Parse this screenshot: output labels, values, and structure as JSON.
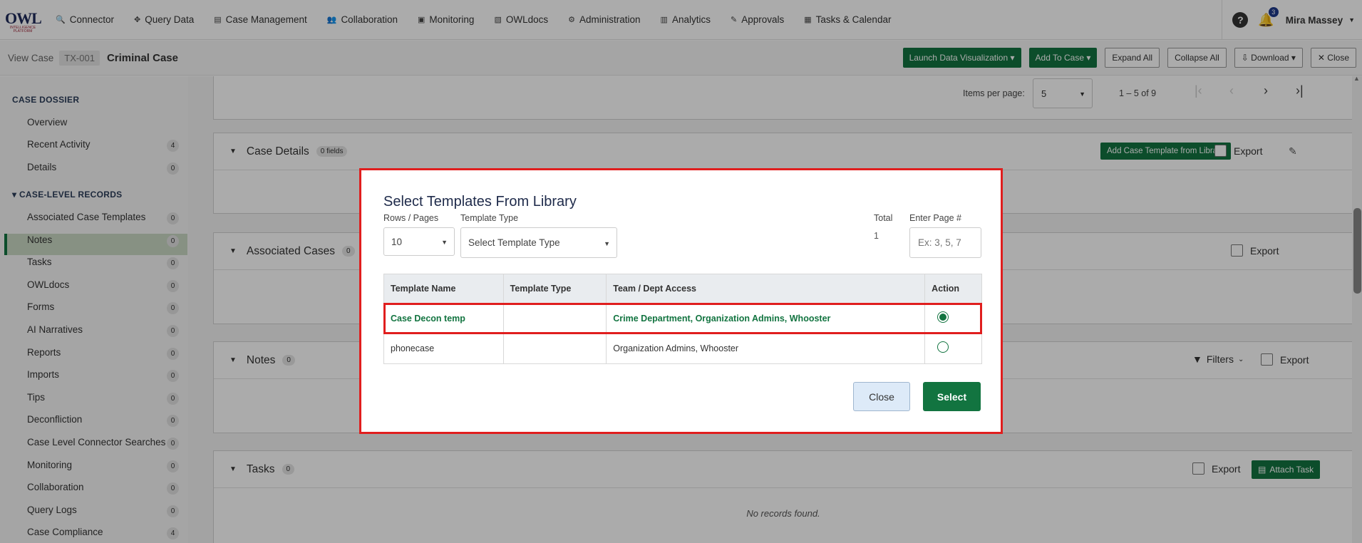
{
  "nav": {
    "logo_text": "OWL",
    "logo_sub": "INTELLIGENCE PLATFORM",
    "items": [
      {
        "label": "Connector",
        "icon": "search-icon",
        "glyph": "🔍"
      },
      {
        "label": "Query Data",
        "icon": "move-icon",
        "glyph": "✥"
      },
      {
        "label": "Case Management",
        "icon": "file-icon",
        "glyph": "▤"
      },
      {
        "label": "Collaboration",
        "icon": "users-icon",
        "glyph": "👥"
      },
      {
        "label": "Monitoring",
        "icon": "monitor-icon",
        "glyph": "▣"
      },
      {
        "label": "OWLdocs",
        "icon": "docs-icon",
        "glyph": "▧"
      },
      {
        "label": "Administration",
        "icon": "admin-icon",
        "glyph": "⚙"
      },
      {
        "label": "Analytics",
        "icon": "analytics-icon",
        "glyph": "▥"
      },
      {
        "label": "Approvals",
        "icon": "signature-icon",
        "glyph": "✎"
      },
      {
        "label": "Tasks & Calendar",
        "icon": "calendar-icon",
        "glyph": "▦"
      }
    ],
    "help_glyph": "?",
    "bell_glyph": "🔔",
    "notifications": "3",
    "user": "Mira Massey"
  },
  "subbar": {
    "view_case": "View Case",
    "case_id": "TX-001",
    "case_name": "Criminal Case",
    "buttons": {
      "launch": "Launch Data Visualization ▾",
      "add": "Add To Case ▾",
      "expand": "Expand All",
      "collapse": "Collapse All",
      "download": "⇩ Download ▾",
      "close": "✕ Close"
    }
  },
  "sidebar": {
    "dossier_header": "CASE DOSSIER",
    "records_header": "▾  CASE-LEVEL RECORDS",
    "dossier_items": [
      {
        "label": "Overview",
        "count": ""
      },
      {
        "label": "Recent Activity",
        "count": "4"
      },
      {
        "label": "Details",
        "count": "0"
      }
    ],
    "record_items": [
      {
        "label": "Associated Case Templates",
        "count": "0"
      },
      {
        "label": "Notes",
        "count": "0"
      },
      {
        "label": "Tasks",
        "count": "0"
      },
      {
        "label": "OWLdocs",
        "count": "0"
      },
      {
        "label": "Forms",
        "count": "0"
      },
      {
        "label": "AI Narratives",
        "count": "0"
      },
      {
        "label": "Reports",
        "count": "0"
      },
      {
        "label": "Imports",
        "count": "0"
      },
      {
        "label": "Tips",
        "count": "0"
      },
      {
        "label": "Deconfliction",
        "count": "0"
      },
      {
        "label": "Case Level Connector Searches",
        "count": "0"
      },
      {
        "label": "Monitoring",
        "count": "0"
      },
      {
        "label": "Collaboration",
        "count": "0"
      },
      {
        "label": "Query Logs",
        "count": "0"
      },
      {
        "label": "Case Compliance",
        "count": "4"
      }
    ]
  },
  "content": {
    "paginator": {
      "items_per_page_label": "Items per page:",
      "items_per_page": "5",
      "range": "1 – 5 of 9"
    },
    "case_details": {
      "title": "Case Details",
      "chip": "0 fields",
      "add_template": "Add Case Template from Library",
      "export": "Export"
    },
    "associated_cases": {
      "title": "Associated Cases",
      "chip": "0",
      "export": "Export"
    },
    "notes": {
      "title": "Notes",
      "chip": "0",
      "filters": "Filters",
      "export": "Export"
    },
    "tasks": {
      "title": "Tasks",
      "chip": "0",
      "export": "Export",
      "attach": "Attach Task",
      "empty": "No records found."
    }
  },
  "modal": {
    "title": "Select Templates From Library",
    "rows_label": "Rows / Pages",
    "rows_value": "10",
    "type_label": "Template Type",
    "type_placeholder": "Select Template Type",
    "total_label": "Total",
    "total_value": "1",
    "page_label": "Enter Page #",
    "page_placeholder": "Ex: 3, 5, 7",
    "columns": [
      "Template Name",
      "Template Type",
      "Team / Dept Access",
      "Action"
    ],
    "rows": [
      {
        "name": "Case Decon temp",
        "type": "",
        "access": "Crime Department, Organization Admins, Whooster",
        "selected": true
      },
      {
        "name": "phonecase",
        "type": "",
        "access": "Organization Admins, Whooster",
        "selected": false
      }
    ],
    "close_label": "Close",
    "select_label": "Select"
  },
  "colors": {
    "brand_green": "#127440",
    "highlight_red": "#e01e1e"
  }
}
